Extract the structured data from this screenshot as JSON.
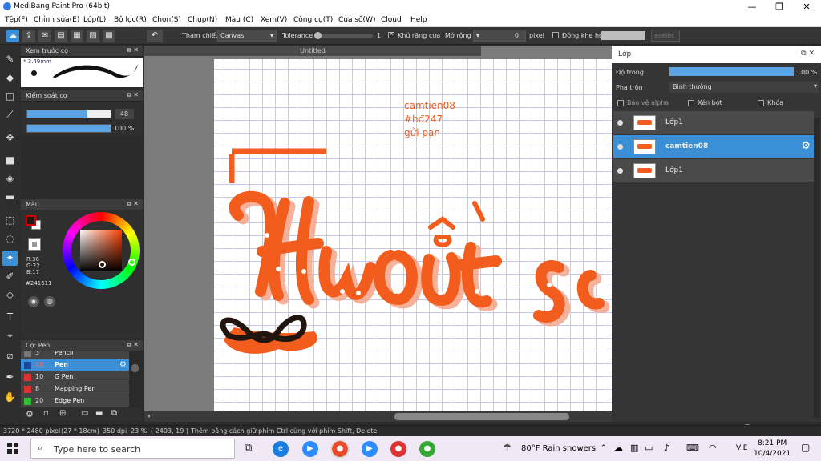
{
  "window": {
    "title": "MediBang Paint Pro (64bit)",
    "min": "—",
    "max": "❐",
    "close": "✕"
  },
  "menu": [
    "Tệp(F)",
    "Chỉnh sửa(E)",
    "Lớp(L)",
    "Bộ lọc(R)",
    "Chọn(S)",
    "Chụp(N)",
    "Màu (C)",
    "Xem(V)",
    "Công cụ(T)",
    "Cửa sổ(W)",
    "Cloud",
    "Help"
  ],
  "toolbar": {
    "ref_label": "Tham chiếu",
    "ref_value": "Canvas",
    "tolerance_label": "Tolerance",
    "tolerance_value": "1",
    "antialias_label": "Khử răng cưa",
    "expand_label": "Mở rộng",
    "expand_value": "0",
    "expand_unit": "pixel",
    "close_gap_label": "Đóng khe hở",
    "select_btn": "eselec"
  },
  "brush_preview": {
    "title": "Xem trước cọ",
    "size": "3.49mm"
  },
  "brush_control": {
    "title": "Kiểm soát cọ",
    "size_value": "48",
    "opacity_value": "100 %",
    "size_fill": 0.72,
    "opacity_fill": 1.0
  },
  "color_panel": {
    "title": "Màu",
    "r": "R:36",
    "g": "G:22",
    "b": "B:17",
    "hex": "#241611",
    "fg_color": "#241611"
  },
  "brush_list": {
    "title": "Cọ: Pen",
    "items": [
      {
        "num": "3",
        "name": "Pencil",
        "color": "#777777"
      },
      {
        "num": "48",
        "name": "Pen",
        "color": "#1a4aa0",
        "selected": true
      },
      {
        "num": "10",
        "name": "G Pen",
        "color": "#e03030"
      },
      {
        "num": "8",
        "name": "Mapping Pen",
        "color": "#e03030"
      },
      {
        "num": "20",
        "name": "Edge Pen",
        "color": "#30c030"
      }
    ]
  },
  "document": {
    "tab": "Untitled",
    "watermark": [
      "camtien08",
      "#hđ247",
      "gửi pạn"
    ],
    "accent": "#f25c1c"
  },
  "layers": {
    "title": "Lớp",
    "opacity_label": "Độ trong",
    "opacity_value": "100 %",
    "opacity_fill": 1.0,
    "blend_label": "Pha trộn",
    "blend_value": "Bình thường",
    "protect_alpha": "Bảo vệ alpha",
    "clip": "Xén bớt",
    "lock": "Khóa",
    "items": [
      {
        "name": "Lớp1",
        "selected": false
      },
      {
        "name": "camtien08",
        "selected": true
      },
      {
        "name": "Lớp1",
        "selected": false
      }
    ]
  },
  "status": {
    "size": "3720 * 2480 pixel",
    "cm": "(27 * 18cm)",
    "dpi": "350 dpi",
    "zoom": "23 %",
    "coords": "( 2403, 19 )",
    "hint": "Thêm bằng cách giữ phím Ctrl cùng với phím Shift, Delete"
  },
  "taskbar": {
    "search_placeholder": "Type here to search",
    "weather": "80°F  Rain showers",
    "lang": "VIE",
    "time": "8:21 PM",
    "date": "10/4/2021"
  }
}
